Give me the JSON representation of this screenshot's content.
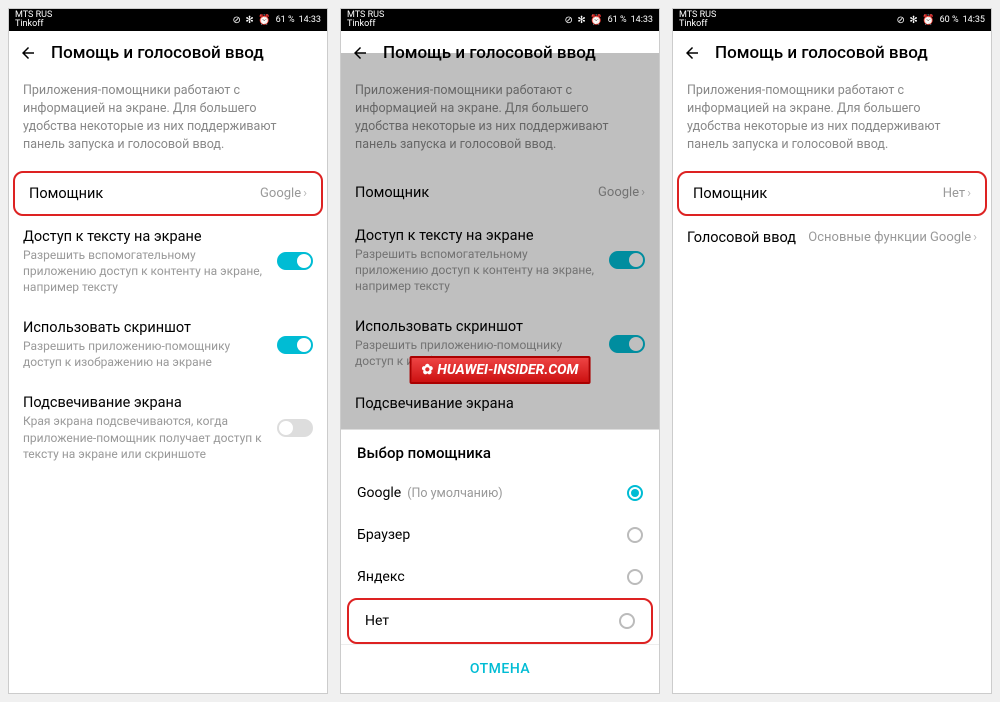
{
  "status": {
    "carrier1": "MTS RUS",
    "carrier2": "Tinkoff",
    "signal": "📶📶",
    "icons": "⊘ ✻ ⏰",
    "battery1": "61 %",
    "time1": "14:33",
    "battery3": "60 %",
    "time3": "14:35"
  },
  "header": {
    "title": "Помощь и голосовой ввод"
  },
  "desc": "Приложения-помощники работают с информацией на экране. Для большего удобства некоторые из них поддерживают панель запуска и голосовой ввод.",
  "rows": {
    "assistant": "Помощник",
    "assistant_val_google": "Google",
    "assistant_val_none": "Нет",
    "text_access": "Доступ к тексту на экране",
    "text_access_sub": "Разрешить вспомогательному приложению доступ к контенту на экране, например тексту",
    "screenshot": "Использовать скриншот",
    "screenshot_sub": "Разрешить приложению-помощнику доступ к изображению на экране",
    "highlight": "Подсвечивание экрана",
    "highlight_sub": "Края экрана подсвечиваются, когда приложение-помощник получает доступ к тексту на экране или скриншоте",
    "voice_input": "Голосовой ввод",
    "voice_input_val": "Основные функции Google"
  },
  "sheet": {
    "title": "Выбор помощника",
    "google": "Google",
    "default": "(По умолчанию)",
    "browser": "Браузер",
    "yandex": "Яндекс",
    "none": "Нет",
    "cancel": "ОТМЕНА"
  },
  "watermark": "HUAWEI-INSIDER.COM"
}
